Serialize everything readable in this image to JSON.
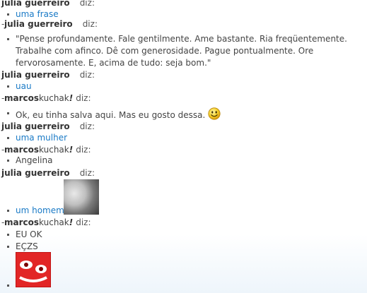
{
  "messages": [
    {
      "sender_name": "julia guerreiro",
      "says": "diz:",
      "text": "uma frase",
      "is_link": true
    },
    {
      "sender_name": "julia guerreiro",
      "says": "diz:",
      "text": "\"Pense profundamente. Fale gentilmente. Ame bastante. Ria freqüentemente. Trabalhe com afinco. Dê com generosidade. Pague pontualmente. Ore fervorosamente. E, acima de tudo: seja bom.\"",
      "is_link": false
    },
    {
      "sender_name": "julia guerreiro",
      "says": "diz:",
      "text": "uau",
      "is_link": true
    },
    {
      "sender_bold": "marcos",
      "sender_rest": "kuchak",
      "sender_excl": "!",
      "says": "diz:",
      "text": "Ok, eu tinha salva aqui. Mas eu gosto dessa.",
      "emoticon": "smiley-face-icon"
    },
    {
      "sender_name": "julia guerreiro",
      "says": "diz:",
      "text": "uma mulher",
      "is_link": true
    },
    {
      "sender_bold": "marcos",
      "sender_rest": "kuchak",
      "sender_excl": "!",
      "says": "diz:",
      "text": "Angelina"
    },
    {
      "sender_name": "julia guerreiro",
      "says": "diz:",
      "text": "um homem",
      "is_link": true,
      "image": "photo-thumbnail"
    },
    {
      "sender_bold": "marcos",
      "sender_rest": "kuchak",
      "sender_excl": "!",
      "says": "diz:",
      "lines": [
        "EU OK",
        "EÇZS"
      ],
      "image": "red-emoticon-image"
    }
  ],
  "colors": {
    "link": "#1a7ac6",
    "text": "#444444",
    "name": "#333333"
  }
}
